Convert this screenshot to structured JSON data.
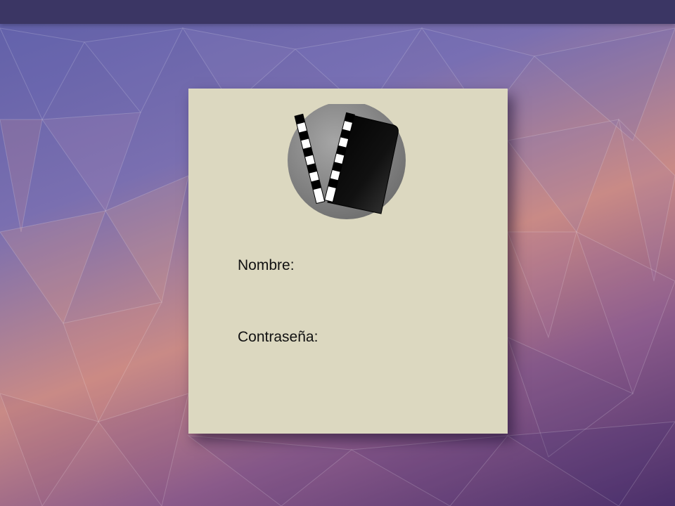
{
  "app": {
    "logo_icon": "clapperboard-icon"
  },
  "login_form": {
    "name_label": "Nombre:",
    "name_value": "",
    "password_label": "Contraseña:",
    "password_value": ""
  },
  "colors": {
    "card_background": "#dcd8c0",
    "top_bar": "#3b3664"
  }
}
